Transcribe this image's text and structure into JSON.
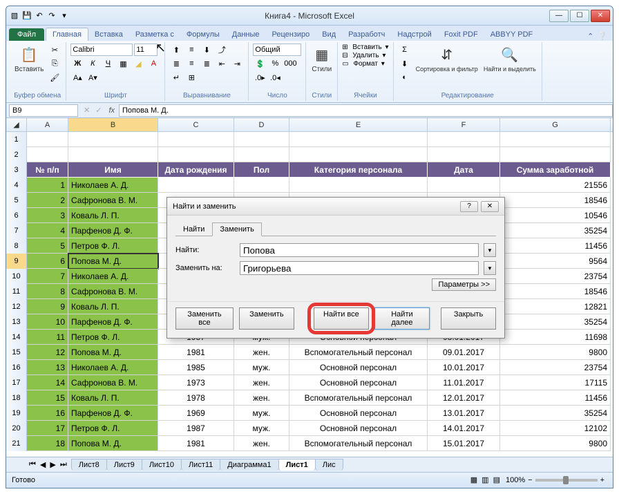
{
  "title": "Книга4  -  Microsoft Excel",
  "ribbon_tabs": {
    "file": "Файл",
    "home": "Главная",
    "insert": "Вставка",
    "layout": "Разметка с",
    "formulas": "Формулы",
    "data": "Данные",
    "review": "Рецензиро",
    "view": "Вид",
    "dev": "Разработч",
    "addins": "Надстрой",
    "foxit": "Foxit PDF",
    "abbyy": "ABBYY PDF"
  },
  "ribbon": {
    "clipboard": {
      "paste": "Вставить",
      "label": "Буфер обмена"
    },
    "font": {
      "name": "Calibri",
      "size": "11",
      "label": "Шрифт"
    },
    "align": {
      "label": "Выравнивание"
    },
    "number": {
      "format": "Общий",
      "label": "Число"
    },
    "styles": {
      "btn": "Стили",
      "label": "Стили"
    },
    "cells": {
      "insert": "Вставить",
      "delete": "Удалить",
      "format": "Формат",
      "label": "Ячейки"
    },
    "editing": {
      "sort": "Сортировка и фильтр",
      "find": "Найти и выделить",
      "label": "Редактирование"
    }
  },
  "namebox": "B9",
  "formula": "Попова М. Д.",
  "columns": [
    "A",
    "B",
    "C",
    "D",
    "E",
    "F",
    "G"
  ],
  "header_row": [
    "№ п/п",
    "Имя",
    "Дата рождения",
    "Пол",
    "Категория персонала",
    "Дата",
    "Сумма заработной"
  ],
  "rows": [
    {
      "r": 4,
      "n": "1",
      "name": "Николаев А. Д.",
      "g": "21556"
    },
    {
      "r": 5,
      "n": "2",
      "name": "Сафронова В. М.",
      "g": "18546"
    },
    {
      "r": 6,
      "n": "3",
      "name": "Коваль Л. П.",
      "g": "10546"
    },
    {
      "r": 7,
      "n": "4",
      "name": "Парфенов Д. Ф.",
      "g": "35254"
    },
    {
      "r": 8,
      "n": "5",
      "name": "Петров Ф. Л.",
      "g": "11456"
    },
    {
      "r": 9,
      "n": "6",
      "name": "Попова М. Д.",
      "g": "9564",
      "sel": true
    },
    {
      "r": 10,
      "n": "7",
      "name": "Николаев А. Д.",
      "g": "23754"
    },
    {
      "r": 11,
      "n": "8",
      "name": "Сафронова В. М.",
      "g": "18546"
    },
    {
      "r": 12,
      "n": "9",
      "name": "Коваль Л. П.",
      "g": "12821"
    },
    {
      "r": 13,
      "n": "10",
      "name": "Парфенов Д. Ф.",
      "g": "35254"
    },
    {
      "r": 14,
      "n": "11",
      "name": "Петров Ф. Л.",
      "c": "1987",
      "d": "муж.",
      "e": "Основной персонал",
      "f": "08.01.2017",
      "g": "11698"
    },
    {
      "r": 15,
      "n": "12",
      "name": "Попова М. Д.",
      "c": "1981",
      "d": "жен.",
      "e": "Вспомогательный персонал",
      "f": "09.01.2017",
      "g": "9800"
    },
    {
      "r": 16,
      "n": "13",
      "name": "Николаев А. Д.",
      "c": "1985",
      "d": "муж.",
      "e": "Основной персонал",
      "f": "10.01.2017",
      "g": "23754"
    },
    {
      "r": 17,
      "n": "14",
      "name": "Сафронова В. М.",
      "c": "1973",
      "d": "жен.",
      "e": "Основной персонал",
      "f": "11.01.2017",
      "g": "17115"
    },
    {
      "r": 18,
      "n": "15",
      "name": "Коваль Л. П.",
      "c": "1978",
      "d": "жен.",
      "e": "Вспомогательный персонал",
      "f": "12.01.2017",
      "g": "11456"
    },
    {
      "r": 19,
      "n": "16",
      "name": "Парфенов Д. Ф.",
      "c": "1969",
      "d": "муж.",
      "e": "Основной персонал",
      "f": "13.01.2017",
      "g": "35254"
    },
    {
      "r": 20,
      "n": "17",
      "name": "Петров Ф. Л.",
      "c": "1987",
      "d": "муж.",
      "e": "Основной персонал",
      "f": "14.01.2017",
      "g": "12102"
    },
    {
      "r": 21,
      "n": "18",
      "name": "Попова М. Д.",
      "c": "1981",
      "d": "жен.",
      "e": "Вспомогательный персонал",
      "f": "15.01.2017",
      "g": "9800"
    }
  ],
  "sheets": [
    "Лист8",
    "Лист9",
    "Лист10",
    "Лист11",
    "Диаграмма1",
    "Лист1",
    "Лис"
  ],
  "active_sheet": "Лист1",
  "status": "Готово",
  "zoom": "100%",
  "dialog": {
    "title": "Найти и заменить",
    "tab_find": "Найти",
    "tab_replace": "Заменить",
    "find_label": "Найти:",
    "find_value": "Попова",
    "replace_label": "Заменить на:",
    "replace_value": "Григорьева",
    "params": "Параметры >>",
    "btn_replace_all": "Заменить все",
    "btn_replace": "Заменить",
    "btn_find_all": "Найти все",
    "btn_find_next": "Найти далее",
    "btn_close": "Закрыть"
  }
}
